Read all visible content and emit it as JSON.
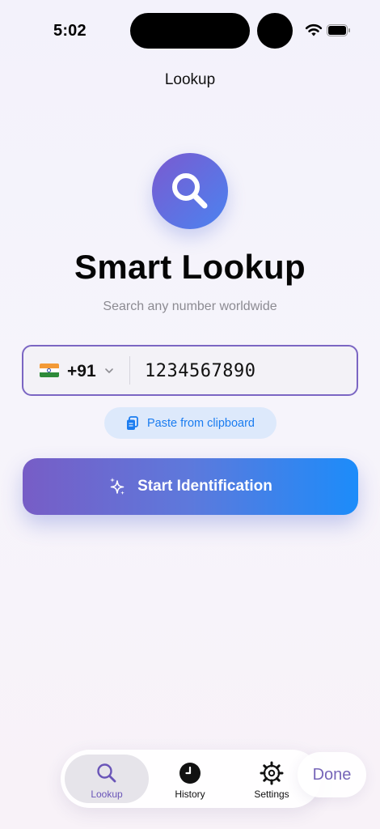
{
  "status_bar": {
    "time": "5:02",
    "wifi_icon": "wifi-icon",
    "battery_icon": "battery-icon"
  },
  "nav": {
    "title": "Lookup"
  },
  "hero": {
    "icon": "search-icon",
    "title": "Smart Lookup",
    "subtitle": "Search any number worldwide"
  },
  "phone_input": {
    "country_flag": "india-flag-icon",
    "dial_code": "+91",
    "value": "1234567890"
  },
  "paste_button": {
    "icon": "clipboard-icon",
    "label": "Paste from clipboard"
  },
  "start_button": {
    "icon": "sparkles-icon",
    "label": "Start Identification"
  },
  "tab_bar": {
    "tabs": [
      {
        "label": "Lookup",
        "icon": "search-icon",
        "active": true
      },
      {
        "label": "History",
        "icon": "clock-icon",
        "active": false
      },
      {
        "label": "Settings",
        "icon": "gear-icon",
        "active": false
      }
    ]
  },
  "done_button": {
    "label": "Done"
  },
  "colors": {
    "accent_purple": "#7b66c3",
    "accent_blue": "#1c8cfa",
    "link_blue": "#1a7cf0"
  }
}
